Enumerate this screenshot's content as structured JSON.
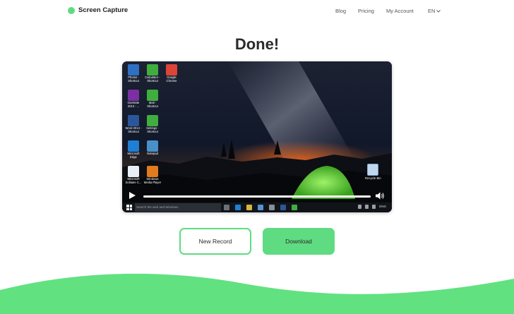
{
  "brand": {
    "name": "Screen Capture",
    "accent": "#5fdc82"
  },
  "nav": {
    "blog": "Blog",
    "pricing": "Pricing",
    "account": "My Account",
    "language": "EN"
  },
  "heading": "Done!",
  "video": {
    "desktop_icons": [
      {
        "label": "Photos - Shortcut",
        "icon": "photos-icon",
        "color": "#2f6fc4"
      },
      {
        "label": "Calculator - Shortcut",
        "icon": "calculator-icon",
        "color": "#3fae3f"
      },
      {
        "label": "Google Chrome",
        "icon": "chrome-icon",
        "color": "#db4437"
      },
      {
        "label": "OneNote 2013 - ...",
        "icon": "onenote-icon",
        "color": "#7b2fa3"
      },
      {
        "label": "Mail - Shortcut",
        "icon": "mail-icon",
        "color": "#3fae3f"
      },
      {
        "label": "",
        "icon": "",
        "color": ""
      },
      {
        "label": "Word 2013 - Shortcut",
        "icon": "word-icon",
        "color": "#2b579a"
      },
      {
        "label": "Settings - Shortcut",
        "icon": "settings-icon",
        "color": "#3fae3f"
      },
      {
        "label": "",
        "icon": "",
        "color": ""
      },
      {
        "label": "Microsoft Edge",
        "icon": "edge-icon",
        "color": "#1f7fd4"
      },
      {
        "label": "Notepad",
        "icon": "notepad-icon",
        "color": "#4a90c8"
      },
      {
        "label": "",
        "icon": "",
        "color": ""
      },
      {
        "label": "Microsoft Solitaire C...",
        "icon": "solitaire-icon",
        "color": "#e8eef5"
      },
      {
        "label": "Windows Media Player",
        "icon": "media-player-icon",
        "color": "#e07b1f"
      }
    ],
    "recycle_bin_label": "Recycle Bin",
    "taskbar_search": "Search the web and Windows",
    "tray_text": "ENG",
    "progress": 0.0
  },
  "buttons": {
    "new_record": "New Record",
    "download": "Download"
  }
}
